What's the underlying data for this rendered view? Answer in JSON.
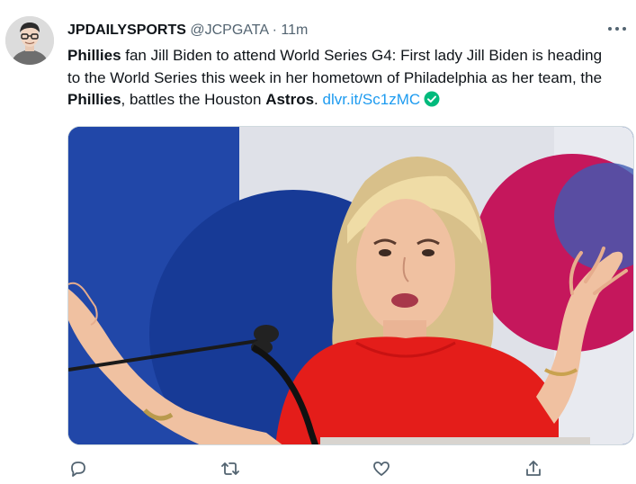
{
  "tweet": {
    "author_name": "JPDAILYSPORTS",
    "author_handle": "@JCPGATA",
    "separator": "·",
    "timestamp": "11m",
    "segments": [
      {
        "text": "Phillies",
        "bold": true
      },
      {
        "text": " fan Jill Biden to attend World Series G4: First lady Jill Biden is heading to the World Series this week in her hometown of Philadelphia as her team, the ",
        "bold": false
      },
      {
        "text": "Phillies",
        "bold": true
      },
      {
        "text": ", battles the Houston ",
        "bold": false
      },
      {
        "text": "Astros",
        "bold": true
      },
      {
        "text": ". ",
        "bold": false
      }
    ],
    "link_text": "dlvr.it/Sc1zMC",
    "check_icon": "check-circle-icon",
    "media": {
      "description_icon": "photo",
      "accent_colors": [
        "#1e3d9a",
        "#e8e8ea",
        "#c8145a",
        "#e8201e"
      ]
    },
    "actions": [
      {
        "icon": "reply-icon"
      },
      {
        "icon": "retweet-icon"
      },
      {
        "icon": "like-icon"
      },
      {
        "icon": "share-icon"
      }
    ],
    "colors": {
      "link": "#1d9bf0",
      "secondary": "#536471",
      "verified": "#00ba7c"
    }
  }
}
